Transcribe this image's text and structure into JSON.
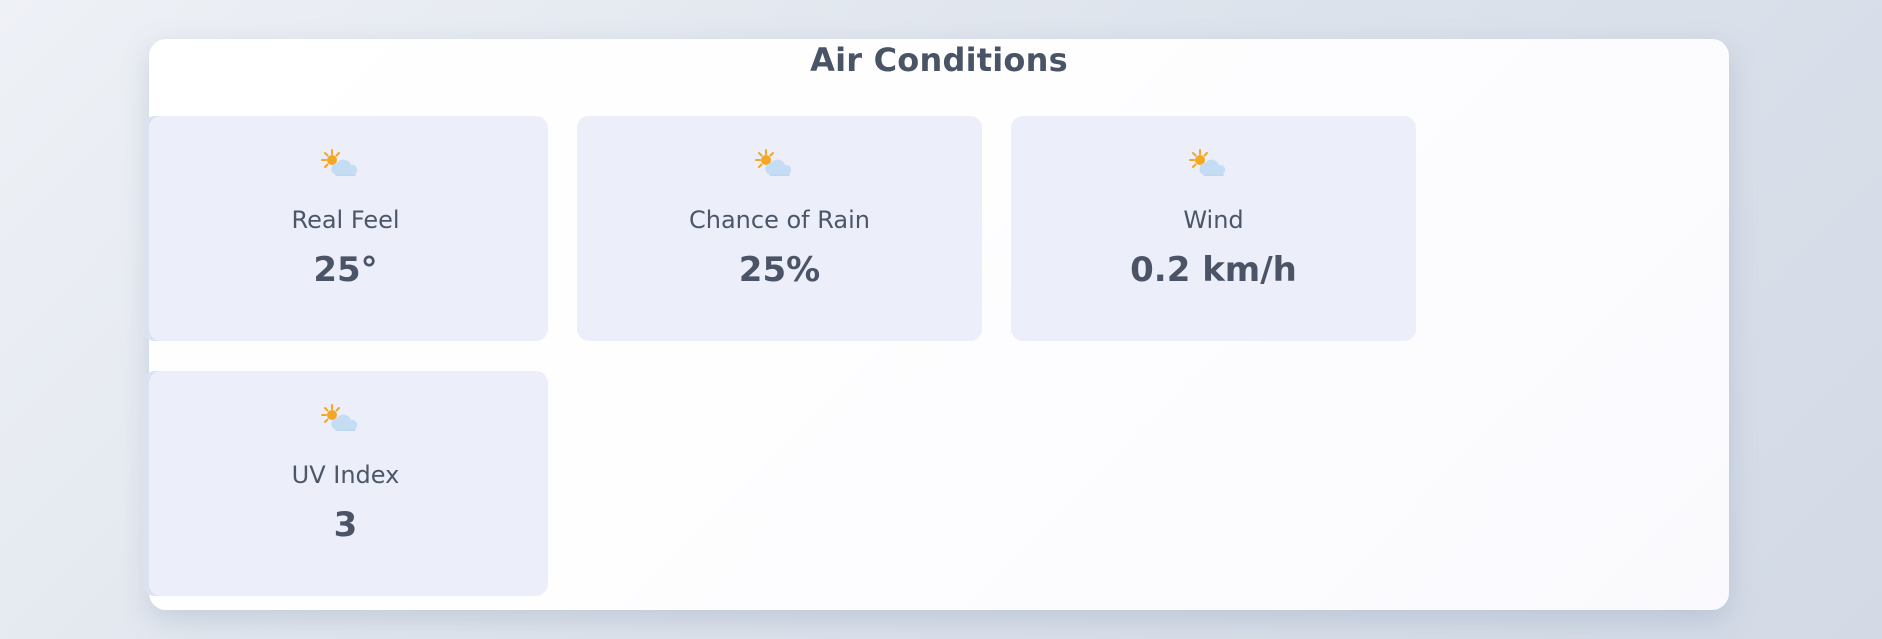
{
  "page_title": "Air Conditions",
  "cards": [
    {
      "label": "Real Feel",
      "value": "25°",
      "icon": "partly-cloudy-icon"
    },
    {
      "label": "Chance of Rain",
      "value": "25%",
      "icon": "partly-cloudy-icon"
    },
    {
      "label": "Wind",
      "value": "0.2 km/h",
      "icon": "partly-cloudy-icon"
    },
    {
      "label": "UV Index",
      "value": "3",
      "icon": "partly-cloudy-icon"
    }
  ],
  "colors": {
    "card_bg": "#eceff9",
    "text": "#4a5466",
    "sun": "#f5a623",
    "cloud": "#c5dcf5"
  }
}
